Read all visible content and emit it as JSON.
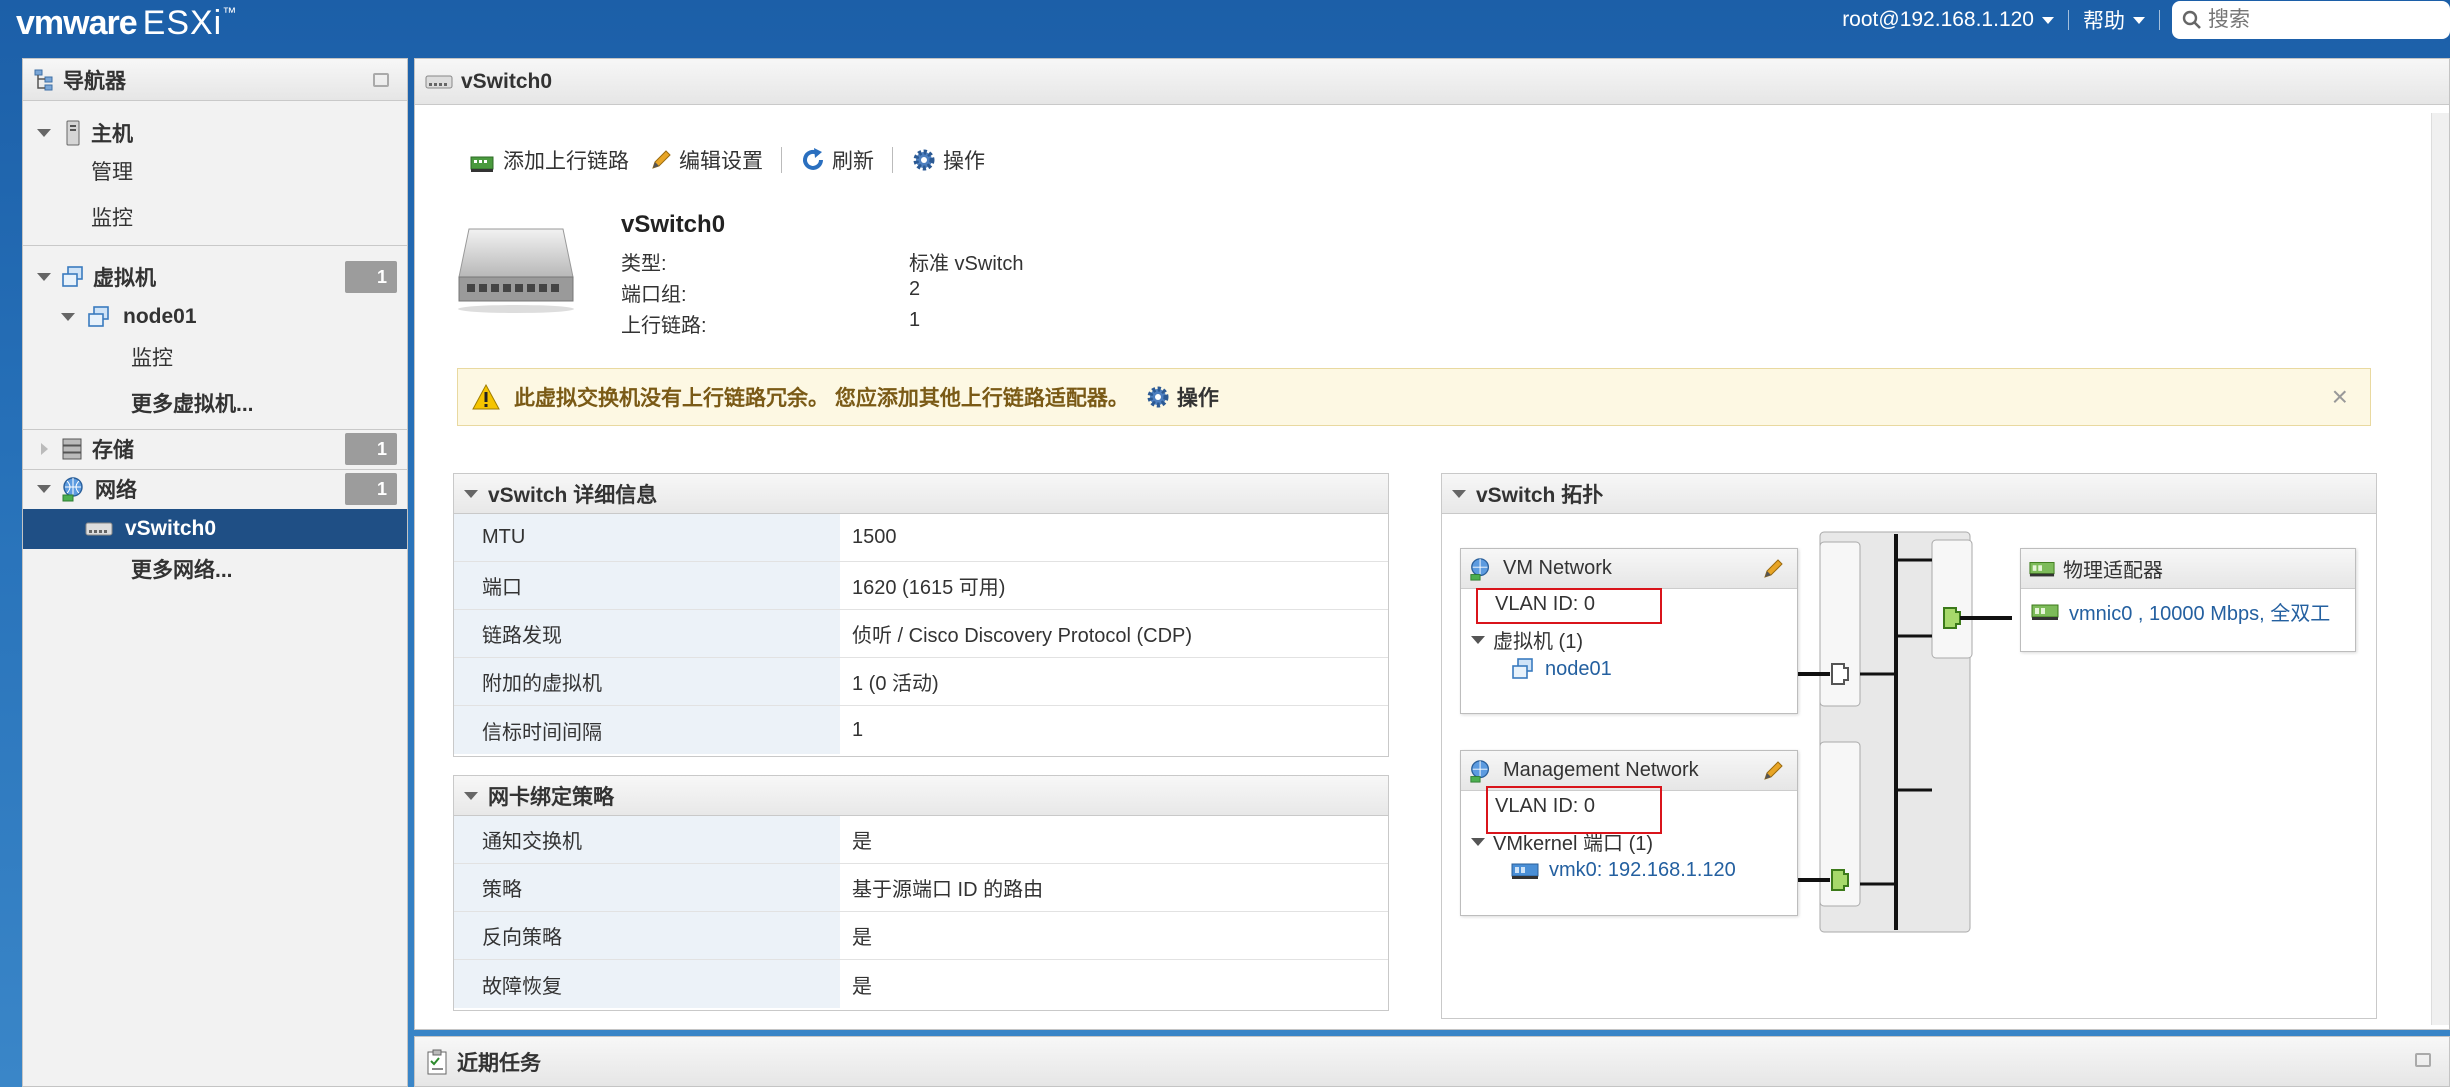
{
  "app": {
    "brand": "vmware",
    "product": "ESXi",
    "trademark": "™"
  },
  "topbar": {
    "user": "root@192.168.1.120",
    "help": "帮助",
    "search_placeholder": "搜索"
  },
  "navigator": {
    "title": "导航器",
    "items": [
      {
        "label": "主机"
      },
      {
        "label": "管理"
      },
      {
        "label": "监控"
      },
      {
        "label": "虚拟机",
        "badge": "1"
      },
      {
        "label": "node01"
      },
      {
        "label": "监控"
      },
      {
        "label": "更多虚拟机..."
      },
      {
        "label": "存储",
        "badge": "1"
      },
      {
        "label": "网络",
        "badge": "1"
      },
      {
        "label": "vSwitch0"
      },
      {
        "label": "更多网络..."
      }
    ]
  },
  "main": {
    "title": "vSwitch0",
    "toolbar": {
      "add_uplink": "添加上行链路",
      "edit": "编辑设置",
      "refresh": "刷新",
      "actions": "操作"
    },
    "summary": {
      "name": "vSwitch0",
      "props": [
        {
          "k": "类型:",
          "v": "标准 vSwitch"
        },
        {
          "k": "端口组:",
          "v": "2"
        },
        {
          "k": "上行链路:",
          "v": "1"
        }
      ]
    },
    "alert": {
      "text": "此虚拟交换机没有上行链路冗余。 您应添加其他上行链路适配器。",
      "action": "操作",
      "close": "×"
    },
    "details": {
      "title": "vSwitch 详细信息",
      "rows": [
        {
          "k": "MTU",
          "v": "1500"
        },
        {
          "k": "端口",
          "v": "1620 (1615 可用)"
        },
        {
          "k": "链路发现",
          "v": "侦听 / Cisco Discovery Protocol (CDP)"
        },
        {
          "k": "附加的虚拟机",
          "v": "1 (0 活动)"
        },
        {
          "k": "信标时间间隔",
          "v": "1"
        }
      ]
    },
    "teaming": {
      "title": "网卡绑定策略",
      "rows": [
        {
          "k": "通知交换机",
          "v": "是"
        },
        {
          "k": "策略",
          "v": "基于源端口 ID 的路由"
        },
        {
          "k": "反向策略",
          "v": "是"
        },
        {
          "k": "故障恢复",
          "v": "是"
        }
      ]
    },
    "topology": {
      "title": "vSwitch 拓扑",
      "vm_network": {
        "name": "VM Network",
        "vlan": "VLAN ID: 0",
        "group": "虚拟机 (1)",
        "member": "node01"
      },
      "mgmt_network": {
        "name": "Management Network",
        "vlan": "VLAN ID: 0",
        "group": "VMkernel 端口 (1)",
        "member": "vmk0: 192.168.1.120"
      },
      "adapters": {
        "title": "物理适配器",
        "nic": "vmnic0 , 10000 Mbps, 全双工"
      }
    }
  },
  "tasks": {
    "title": "近期任务"
  }
}
